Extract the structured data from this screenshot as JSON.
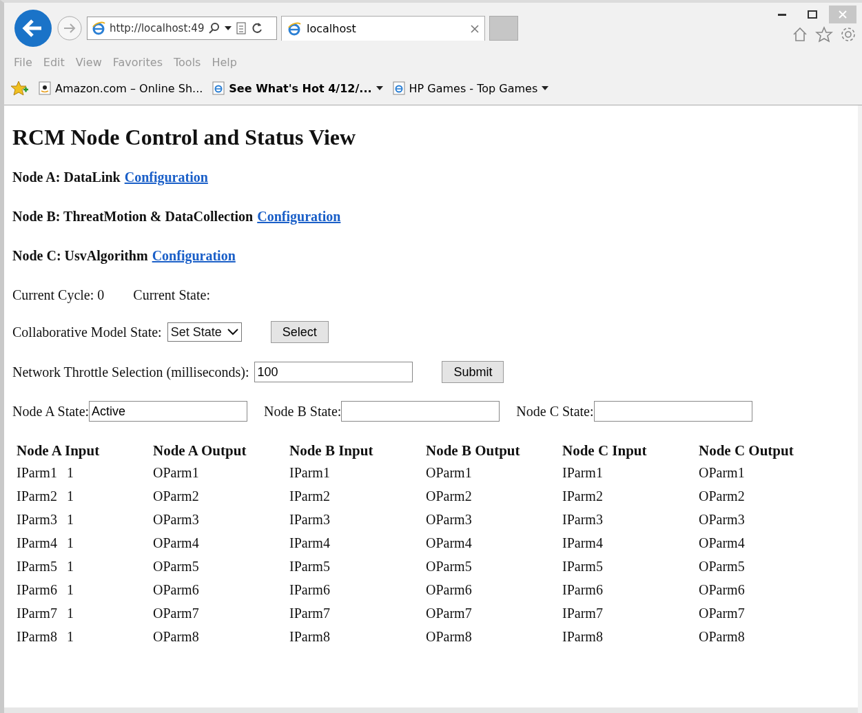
{
  "browser": {
    "address": "http://localhost:49",
    "tab_title": "localhost",
    "menu": [
      "File",
      "Edit",
      "View",
      "Favorites",
      "Tools",
      "Help"
    ],
    "favorites": [
      {
        "label": "Amazon.com – Online Sh...",
        "kind": "amazon",
        "dropdown": false,
        "bold": false
      },
      {
        "label": "See What's Hot 4/12/...",
        "kind": "page",
        "dropdown": true,
        "bold": true
      },
      {
        "label": "HP Games - Top Games",
        "kind": "page",
        "dropdown": true,
        "bold": false
      }
    ]
  },
  "page": {
    "title": "RCM Node Control and Status View",
    "nodes": [
      {
        "label": "Node A: DataLink",
        "link": "Configuration"
      },
      {
        "label": "Node B: ThreatMotion & DataCollection",
        "link": "Configuration"
      },
      {
        "label": "Node C: UsvAlgorithm",
        "link": "Configuration"
      }
    ],
    "cycle": "Current Cycle: 0",
    "state": "Current State:",
    "model_state": {
      "label": "Collaborative Model State:",
      "select_value": "Set State",
      "button": "Select"
    },
    "throttle": {
      "label": "Network Throttle Selection (milliseconds):",
      "value": "100",
      "button": "Submit"
    },
    "node_states": [
      {
        "label": "Node A State:",
        "value": "Active"
      },
      {
        "label": "Node B State:"
      },
      {
        "label": "Node C State:"
      }
    ],
    "table": {
      "columns": [
        "Node A Input",
        "Node A Output",
        "Node B Input",
        "Node B Output",
        "Node C Input",
        "Node C Output"
      ],
      "rows": [
        {
          "cells": [
            "IParm1",
            "OParm1",
            "IParm1",
            "OParm1",
            "IParm1",
            "OParm1"
          ],
          "value": "1"
        },
        {
          "cells": [
            "IParm2",
            "OParm2",
            "IParm2",
            "OParm2",
            "IParm2",
            "OParm2"
          ],
          "value": "1"
        },
        {
          "cells": [
            "IParm3",
            "OParm3",
            "IParm3",
            "OParm3",
            "IParm3",
            "OParm3"
          ],
          "value": "1"
        },
        {
          "cells": [
            "IParm4",
            "OParm4",
            "IParm4",
            "OParm4",
            "IParm4",
            "OParm4"
          ],
          "value": "1"
        },
        {
          "cells": [
            "IParm5",
            "OParm5",
            "IParm5",
            "OParm5",
            "IParm5",
            "OParm5"
          ],
          "value": "1"
        },
        {
          "cells": [
            "IParm6",
            "OParm6",
            "IParm6",
            "OParm6",
            "IParm6",
            "OParm6"
          ],
          "value": "1"
        },
        {
          "cells": [
            "IParm7",
            "OParm7",
            "IParm7",
            "OParm7",
            "IParm7",
            "OParm7"
          ],
          "value": "1"
        },
        {
          "cells": [
            "IParm8",
            "OParm8",
            "IParm8",
            "OParm8",
            "IParm8",
            "OParm8"
          ],
          "value": "1"
        }
      ]
    }
  }
}
